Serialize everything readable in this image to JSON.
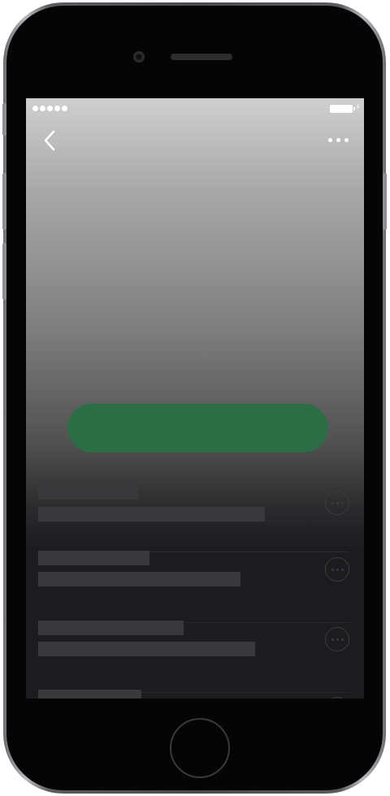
{
  "device": {
    "frame_color": "#4a4b4f",
    "icons": [
      "camera-icon",
      "speaker-grille",
      "home-button"
    ]
  },
  "screen": {
    "background_gradient": [
      "#cfcfcf",
      "#1c1c1e"
    ],
    "status_bar": {
      "signal_icon": "signal-dots-icon",
      "battery_icon": "battery-icon",
      "charging_icon": "bolt-icon",
      "charging_glyph": "⚡"
    },
    "nav": {
      "back_icon": "chevron-left-icon",
      "more_icon": "ellipsis-icon"
    },
    "primary_button": {
      "label": "",
      "color": "#2d6d45"
    },
    "track_list": {
      "placeholder_color": "#39393b",
      "menu_icon": "more-circle-icon",
      "rows": [
        {
          "title": "",
          "subtitle": ""
        },
        {
          "title": "",
          "subtitle": ""
        },
        {
          "title": "",
          "subtitle": ""
        },
        {
          "title": "",
          "subtitle": ""
        }
      ]
    }
  }
}
